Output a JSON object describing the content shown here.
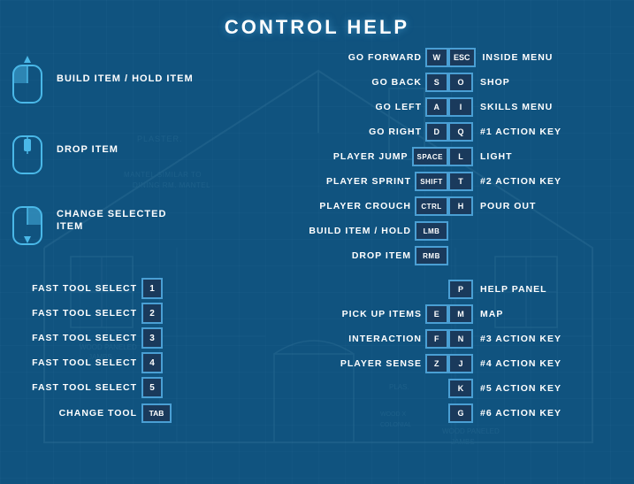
{
  "title": "CONTROL HELP",
  "mouse_controls": [
    {
      "label": "BUILD ITEM / HOLD ITEM",
      "type": "scroll_up"
    },
    {
      "label": "DROP ITEM",
      "type": "scroll_mid"
    },
    {
      "label": "CHANGE SELECTED ITEM",
      "type": "scroll_down"
    }
  ],
  "movement_keys": [
    {
      "label": "GO FORWARD",
      "key": "W"
    },
    {
      "label": "GO BACK",
      "key": "S"
    },
    {
      "label": "GO LEFT",
      "key": "A"
    },
    {
      "label": "GO RIGHT",
      "key": "D"
    },
    {
      "label": "PLAYER JUMP",
      "key": "SPACE"
    },
    {
      "label": "PLAYER SPRINT",
      "key": "SHIFT"
    },
    {
      "label": "PLAYER CROUCH",
      "key": "CTRL"
    },
    {
      "label": "BUILD ITEM / HOLD",
      "key": "LMB"
    },
    {
      "label": "DROP ITEM",
      "key": "RMB"
    }
  ],
  "action_keys_right": [
    {
      "label": "INSIDE MENU",
      "key": "ESC"
    },
    {
      "label": "SHOP",
      "key": "O"
    },
    {
      "label": "SKILLS MENU",
      "key": "I"
    },
    {
      "label": "#1 ACTION KEY",
      "key": "Q"
    },
    {
      "label": "LIGHT",
      "key": "L"
    },
    {
      "label": "#2 ACTION KEY",
      "key": "T"
    },
    {
      "label": "POUR OUT",
      "key": "H"
    }
  ],
  "fast_tool_keys": [
    {
      "label": "FAST TOOL SELECT",
      "key": "1"
    },
    {
      "label": "FAST TOOL SELECT",
      "key": "2"
    },
    {
      "label": "FAST TOOL SELECT",
      "key": "3"
    },
    {
      "label": "FAST TOOL SELECT",
      "key": "4"
    },
    {
      "label": "FAST TOOL SELECT",
      "key": "5"
    }
  ],
  "change_tool": {
    "label": "CHANGE TOOL",
    "key": "TAB"
  },
  "pickup_keys": [
    {
      "label": "PICK UP ITEMS",
      "key": "E"
    },
    {
      "label": "INTERACTION",
      "key": "F"
    },
    {
      "label": "PLAYER SENSE",
      "key": "Z"
    }
  ],
  "misc_keys": [
    {
      "label": "HELP PANEL",
      "key": "P"
    },
    {
      "label": "MAP",
      "key": "M"
    },
    {
      "label": "#3 ACTION KEY",
      "key": "N"
    },
    {
      "label": "#4 ACTION KEY",
      "key": "J"
    },
    {
      "label": "#5 ACTION KEY",
      "key": "K"
    },
    {
      "label": "#6 ACTION KEY",
      "key": "G"
    }
  ]
}
